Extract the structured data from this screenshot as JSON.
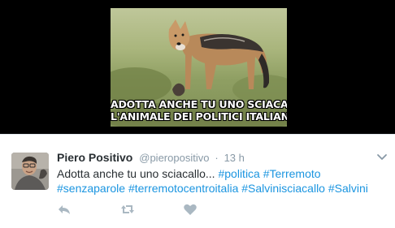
{
  "media": {
    "caption_line1": "ADOTTA ANCHE TU UNO SCIACALLO,",
    "caption_line2": "L'ANIMALE DEI POLITICI ITALIANI"
  },
  "tweet": {
    "fullname": "Piero Positivo",
    "handle": "@pieropositivo",
    "separator": "·",
    "time": "13 h",
    "text_plain": "Adotta anche tu uno sciacallo... ",
    "hashtags": [
      "#politica",
      "#Terremoto",
      "#senzaparole",
      "#terremotocentroitalia",
      "#Salvinisciacallo",
      "#Salvini"
    ]
  },
  "icons": {
    "caret": "chevron-down-icon",
    "reply": "reply-icon",
    "retweet": "retweet-icon",
    "like": "heart-icon"
  },
  "colors": {
    "link": "#1b95e0",
    "text": "#292f33",
    "muted": "#8899a6",
    "action_icon": "#aab8c2"
  }
}
